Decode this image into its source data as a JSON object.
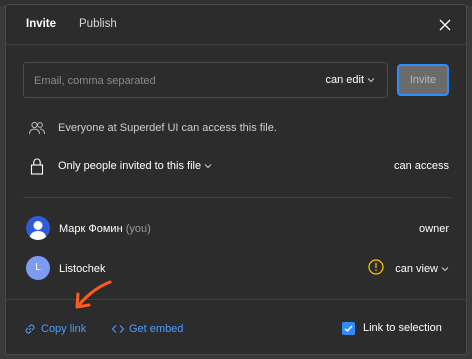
{
  "tabs": [
    {
      "label": "Invite",
      "active": true
    },
    {
      "label": "Publish",
      "active": false
    }
  ],
  "invite": {
    "placeholder": "Email, comma separated",
    "value": "",
    "permission": "can edit",
    "button_label": "Invite"
  },
  "org_access": {
    "text": "Everyone at Superdef UI can access this file."
  },
  "restriction": {
    "label": "Only people invited to this file",
    "access_label": "can access"
  },
  "users": [
    {
      "name": "Марк Фомин",
      "suffix": "(you)",
      "role": "owner",
      "avatar_letter": ""
    },
    {
      "name": "Listochek",
      "suffix": "",
      "role": "can view",
      "avatar_letter": "L"
    }
  ],
  "footer": {
    "copy_link": "Copy link",
    "get_embed": "Get embed",
    "link_to_selection": "Link to selection",
    "link_to_selection_checked": true
  },
  "colors": {
    "accent": "#2f8cff",
    "link": "#4f9cff",
    "warning": "#ffc700",
    "annotation_arrow": "#ff5a1f",
    "background": "#2c2c2c"
  }
}
